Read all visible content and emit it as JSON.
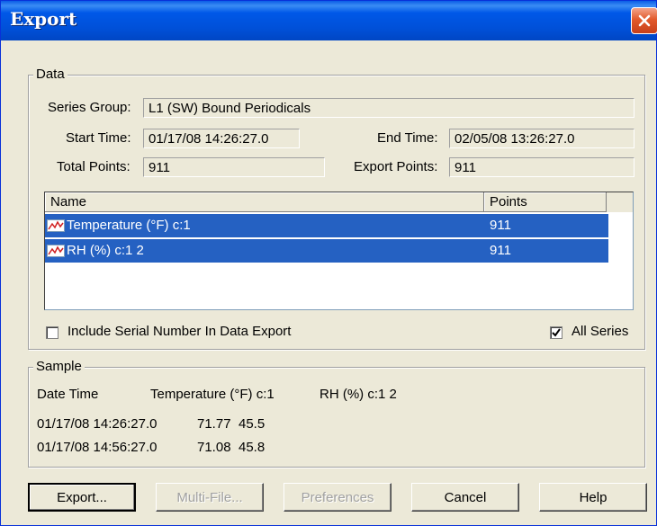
{
  "window": {
    "title": "Export"
  },
  "data_group": {
    "legend": "Data",
    "series_group_label": "Series Group:",
    "series_group_value": "L1 (SW)  Bound Periodicals",
    "start_time_label": "Start Time:",
    "start_time_value": "01/17/08 14:26:27.0",
    "end_time_label": "End Time:",
    "end_time_value": "02/05/08 13:26:27.0",
    "total_points_label": "Total Points:",
    "total_points_value": "911",
    "export_points_label": "Export Points:",
    "export_points_value": "911",
    "list": {
      "columns": [
        "Name",
        "Points"
      ],
      "rows": [
        {
          "name": "Temperature (°F) c:1",
          "points": "911",
          "selected": true,
          "icon": "series-line-icon"
        },
        {
          "name": "RH (%) c:1 2",
          "points": "911",
          "selected": true,
          "icon": "series-line-icon"
        }
      ]
    },
    "include_serial_label": "Include Serial Number In Data Export",
    "include_serial_checked": false,
    "all_series_label": "All Series",
    "all_series_checked": true
  },
  "sample_group": {
    "legend": "Sample",
    "headers": [
      "Date Time",
      "Temperature (°F) c:1",
      "RH (%) c:1 2"
    ],
    "rows": [
      [
        "01/17/08 14:26:27.0",
        "71.77",
        "45.5"
      ],
      [
        "01/17/08 14:56:27.0",
        "71.08",
        "45.8"
      ]
    ]
  },
  "buttons": {
    "export": "Export...",
    "multi_file": "Multi-File...",
    "preferences": "Preferences",
    "cancel": "Cancel",
    "help": "Help"
  },
  "colors": {
    "title_bar": "#0054e3",
    "selection": "#2561c2",
    "close_button": "#e25a2c"
  }
}
